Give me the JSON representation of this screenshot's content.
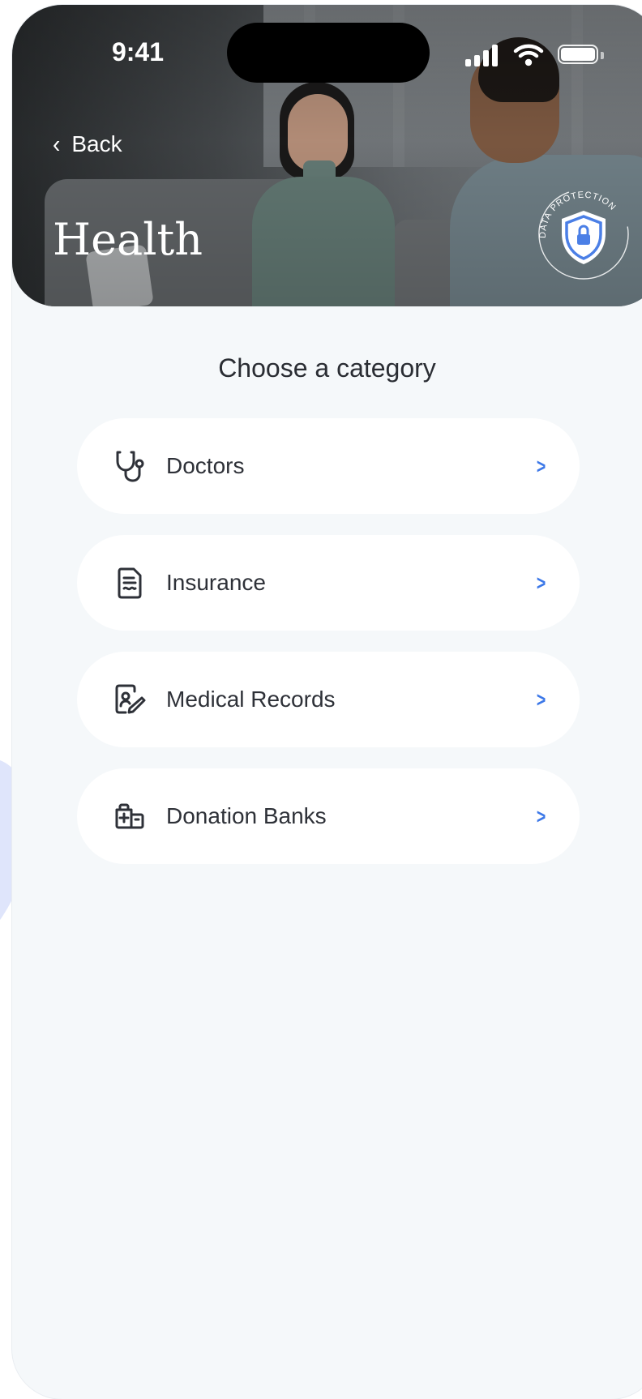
{
  "status_bar": {
    "time": "9:41"
  },
  "header": {
    "back_label": "Back",
    "title": "Health",
    "badge_text": "DATA PROTECTION"
  },
  "main": {
    "heading": "Choose a category",
    "categories": [
      {
        "label": "Doctors",
        "icon": "stethoscope-icon"
      },
      {
        "label": "Insurance",
        "icon": "document-icon"
      },
      {
        "label": "Medical Records",
        "icon": "medical-record-icon"
      },
      {
        "label": "Donation Banks",
        "icon": "donation-bank-icon"
      }
    ]
  },
  "colors": {
    "accent": "#3C78E8",
    "background": "#F5F8FA",
    "card": "#FFFFFF",
    "text": "#2E3138"
  }
}
